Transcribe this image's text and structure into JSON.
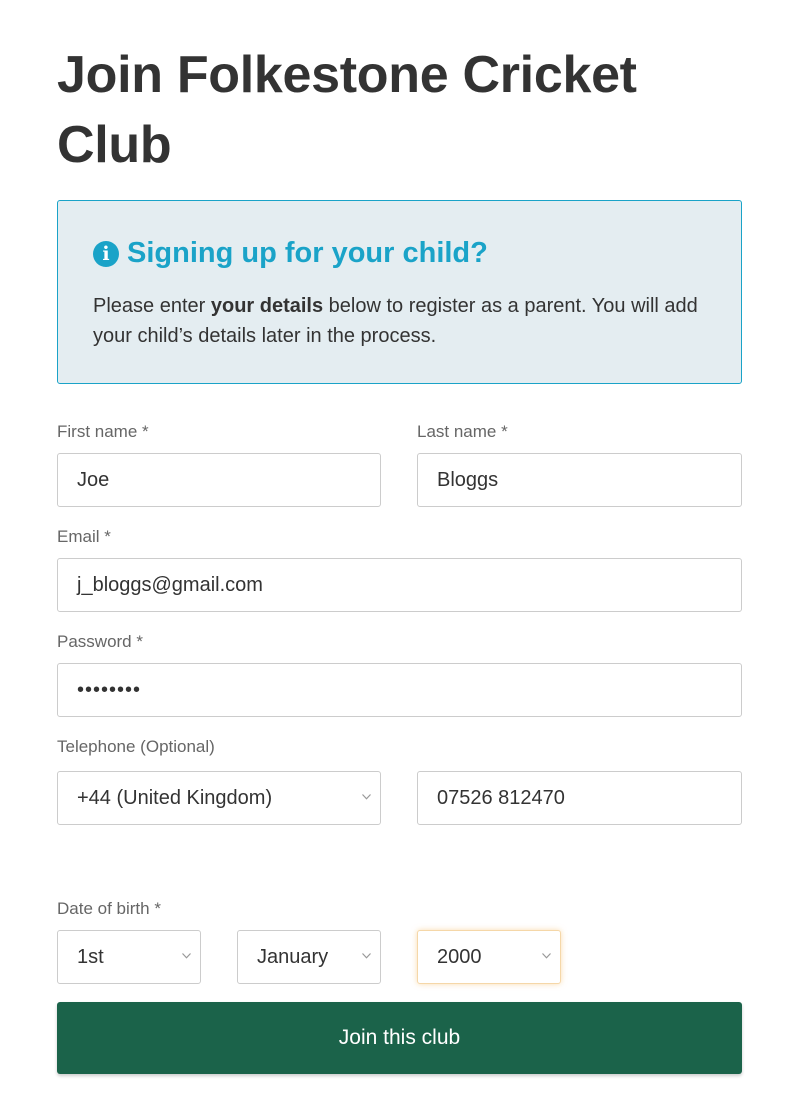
{
  "page": {
    "title": "Join Folkestone Cricket Club"
  },
  "notice": {
    "icon": "info-circle-icon",
    "heading": "Signing up for your child?",
    "text_before": "Please enter ",
    "text_bold": "your details",
    "text_after": " below to register as a parent. You will add your child’s details later in the process."
  },
  "form": {
    "first_name": {
      "label": "First name *",
      "value": "Joe"
    },
    "last_name": {
      "label": "Last name *",
      "value": "Bloggs"
    },
    "email": {
      "label": "Email *",
      "value": "j_bloggs@gmail.com"
    },
    "password": {
      "label": "Password *",
      "value": "••••••••"
    },
    "telephone": {
      "label": "Telephone (Optional)",
      "country_code": "+44 (United Kingdom)",
      "number": "07526 812470"
    },
    "date_of_birth": {
      "label": "Date of birth *",
      "day": "1st",
      "month": "January",
      "year": "2000"
    },
    "submit_label": "Join this club"
  },
  "colors": {
    "accent": "#1aa3c8",
    "notice_bg": "#e4edf1",
    "button": "#1b634a",
    "focus": "#f5d7a8"
  }
}
